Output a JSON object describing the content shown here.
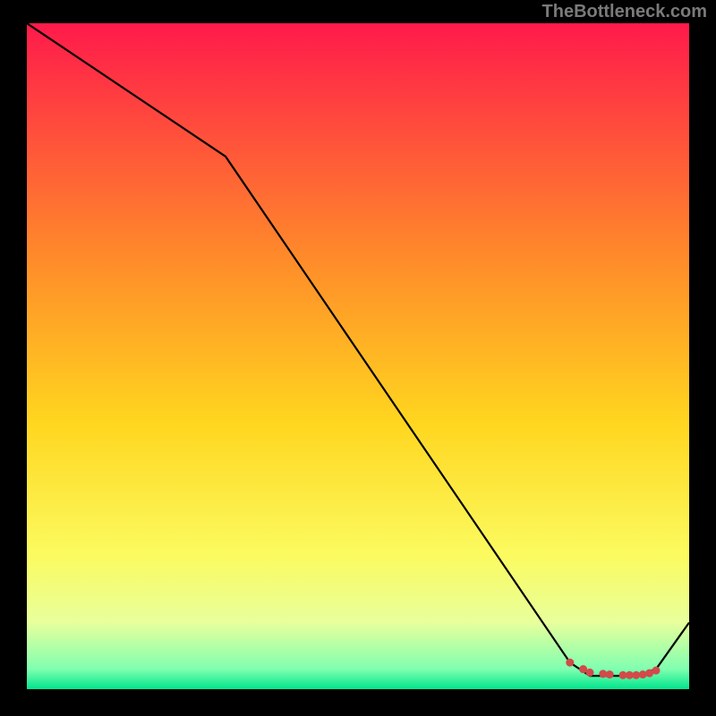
{
  "watermark": "TheBottleneck.com",
  "chart_data": {
    "type": "line",
    "title": "",
    "xlabel": "",
    "ylabel": "",
    "xlim": [
      0,
      100
    ],
    "ylim": [
      0,
      100
    ],
    "grid": false,
    "legend": false,
    "background_gradient_stops": [
      {
        "offset": 0,
        "color": "#ff1a4b"
      },
      {
        "offset": 35,
        "color": "#ff8a2a"
      },
      {
        "offset": 60,
        "color": "#ffd61f"
      },
      {
        "offset": 80,
        "color": "#fbfb60"
      },
      {
        "offset": 90,
        "color": "#e8ff9c"
      },
      {
        "offset": 97,
        "color": "#7fffb0"
      },
      {
        "offset": 100,
        "color": "#00e58c"
      }
    ],
    "series": [
      {
        "name": "curve",
        "color": "#000000",
        "x": [
          0,
          30,
          82,
          85,
          88,
          92,
          95,
          100
        ],
        "values": [
          100,
          80,
          4,
          2,
          2,
          2,
          3,
          10
        ]
      }
    ],
    "markers": {
      "name": "highlight-points",
      "color": "#d24a4a",
      "x": [
        82,
        84,
        85,
        87,
        88,
        90,
        91,
        92,
        93,
        94,
        95
      ],
      "values": [
        4,
        3,
        2.5,
        2.3,
        2.2,
        2.1,
        2.1,
        2.1,
        2.2,
        2.4,
        2.8
      ]
    }
  }
}
